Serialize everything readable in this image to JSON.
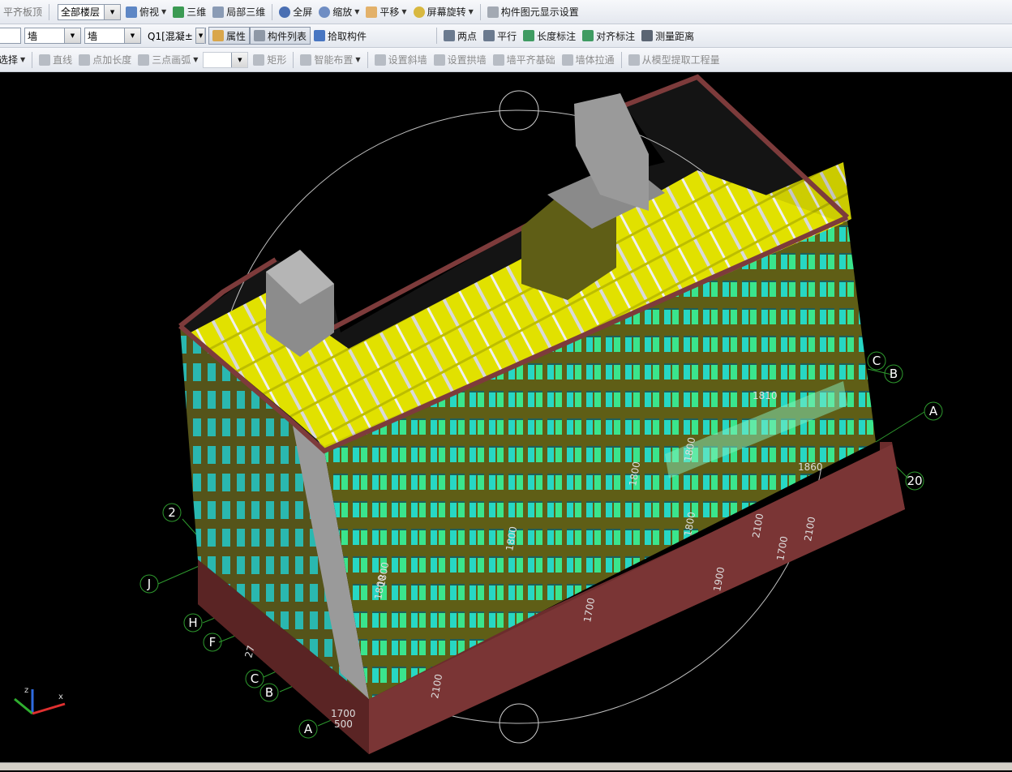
{
  "toolbar1": {
    "panel_label": "平齐板顶",
    "floor_select": "全部楼层",
    "top_view": "俯视",
    "three_d": "三维",
    "partial_3d": "局部三维",
    "full_screen": "全屏",
    "zoom": "缩放",
    "pan": "平移",
    "rotate_screen": "屏幕旋转",
    "display_settings": "构件图元显示设置"
  },
  "toolbar2": {
    "category_select": "墙",
    "type_select": "墙",
    "component_select": "Q1[混凝±",
    "properties": "属性",
    "component_list": "构件列表",
    "pick_component": "拾取构件",
    "two_points": "两点",
    "parallel": "平行",
    "length_annot": "长度标注",
    "align_annot": "对齐标注",
    "measure_distance": "测量距离"
  },
  "toolbar3": {
    "select": "选择",
    "line": "直线",
    "point_length": "点加长度",
    "three_point_arc": "三点画弧",
    "rectangle": "矩形",
    "smart_layout": "智能布置",
    "set_slope_wall": "设置斜墙",
    "set_arch_wall": "设置拱墙",
    "wall_align_foundation": "墙平齐基础",
    "wall_pull_through": "墙体拉通",
    "extract_quantity": "从模型提取工程量"
  },
  "axis_labels": [
    "2",
    "J",
    "H",
    "F",
    "C",
    "B",
    "A",
    "C",
    "B",
    "A",
    "20"
  ],
  "dimension_labels": [
    "27",
    "1700",
    "500",
    "2100",
    "1700",
    "1900",
    "1700",
    "2100",
    "2100",
    "1800",
    "1800",
    "1800",
    "1800",
    "1800",
    "1810",
    "1860",
    "1800"
  ],
  "colors": {
    "toolbar_bg": "#e9edf3",
    "viewport_bg": "#000000",
    "wall_olive": "#5f5e16",
    "base_maroon": "#6b2c2c",
    "window_cyan": "#27d7c4",
    "room_yellow": "#e1e100",
    "axis_green": "#2e9a2e"
  }
}
